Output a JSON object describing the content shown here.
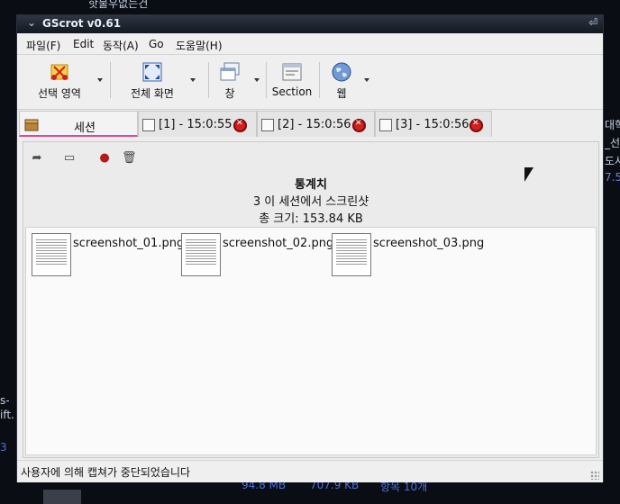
{
  "desktop": {
    "top_text": "핫불우없는건",
    "top_text2": "ᅮ",
    "right_texts": [
      "대학",
      "_선",
      "도사",
      "7.5"
    ],
    "left_texts": [
      "s-",
      "ift.",
      "3"
    ],
    "bottom_texts": [
      "94.8 MB",
      "707.9 KB",
      "항목 10개"
    ]
  },
  "window": {
    "title": "GScrot v0.61",
    "collapse_icon": "chevron-down",
    "close_icon": "close"
  },
  "menu": [
    "파일(F)",
    "Edit",
    "동작(A)",
    "Go",
    "도움말(H)"
  ],
  "toolbar": {
    "select": "선택 영역",
    "fullscreen": "전체 화면",
    "window": "창",
    "section": "Section",
    "web": "웹"
  },
  "tabs": [
    {
      "label": "세션",
      "icon": "session-box"
    },
    {
      "label": "[1] - 15:0:55",
      "icon": "screenshot-thumb"
    },
    {
      "label": "[2] - 15:0:56",
      "icon": "screenshot-thumb"
    },
    {
      "label": "[3] - 15:0:56",
      "icon": "screenshot-thumb"
    }
  ],
  "content": {
    "tools": [
      "send-icon",
      "print-icon",
      "upload-icon",
      "trash-icon"
    ],
    "stats_heading": "통계치",
    "stats_line1": "3 이 세션에서 스크린샷",
    "stats_line2": "총 크기: 153.84 KB",
    "files": [
      "screenshot_01.png",
      "screenshot_02.png",
      "screenshot_03.png"
    ]
  },
  "status": {
    "message": "사용자에 의해 캡쳐가 중단되었습니다"
  },
  "colors": {
    "tab_accent": "#d94a9a",
    "close_red": "#d21f1f"
  }
}
